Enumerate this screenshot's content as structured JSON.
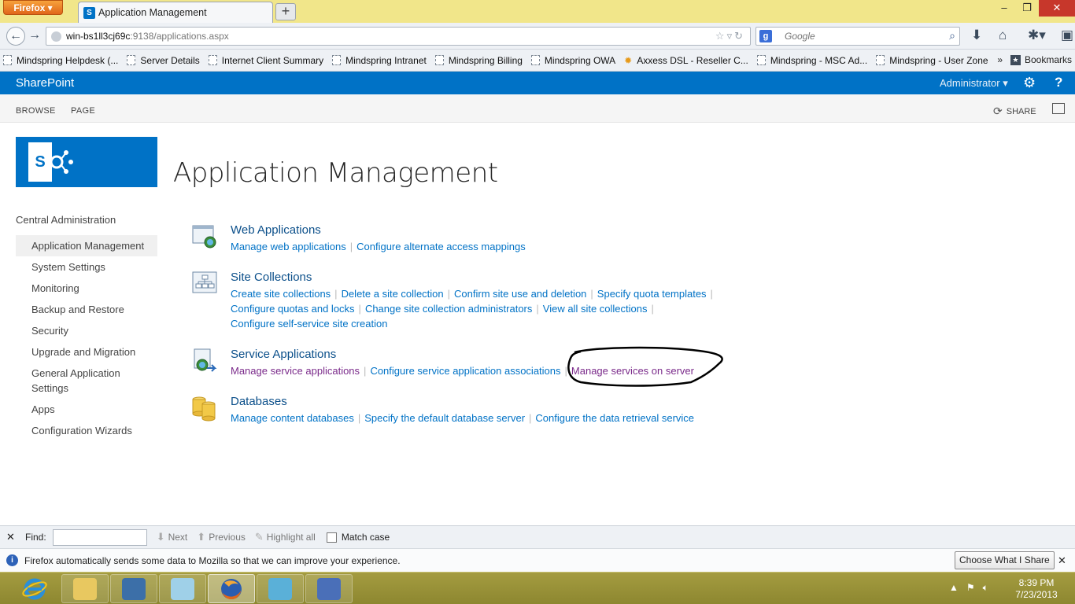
{
  "browser": {
    "menu_button": "Firefox",
    "tab_title": "Application Management",
    "new_tab": "+",
    "window_controls": {
      "minimize": "–",
      "maximize": "❐",
      "close": "✕"
    },
    "url_host": "win-bs1ll3cj69c",
    "url_rest": ":9138/applications.aspx",
    "search_placeholder": "Google",
    "bookmarks": [
      {
        "label": "Mindspring Helpdesk (...",
        "icon": "page-icon"
      },
      {
        "label": "Server Details",
        "icon": "page-icon"
      },
      {
        "label": "Internet Client Summary",
        "icon": "page-icon"
      },
      {
        "label": "Mindspring Intranet",
        "icon": "page-icon"
      },
      {
        "label": "Mindspring Billing",
        "icon": "page-icon"
      },
      {
        "label": "Mindspring OWA",
        "icon": "page-icon"
      },
      {
        "label": "Axxess DSL - Reseller C...",
        "icon": "star-icon"
      },
      {
        "label": "Mindspring - MSC Ad...",
        "icon": "page-icon"
      },
      {
        "label": "Mindspring - User Zone",
        "icon": "page-icon"
      }
    ],
    "bookmarks_more": "»",
    "bookmarks_menu": "Bookmarks"
  },
  "suite": {
    "brand": "SharePoint",
    "user": "Administrator ▾",
    "settings_icon": "gear-icon",
    "help_icon": "help-icon",
    "help_label": "?"
  },
  "ribbon": {
    "tabs": [
      "BROWSE",
      "PAGE"
    ],
    "share": "SHARE"
  },
  "page": {
    "title": "Application Management"
  },
  "quicklaunch": {
    "root": "Central Administration",
    "items": [
      {
        "label": "Application Management",
        "active": true
      },
      {
        "label": "System Settings"
      },
      {
        "label": "Monitoring"
      },
      {
        "label": "Backup and Restore"
      },
      {
        "label": "Security"
      },
      {
        "label": "Upgrade and Migration"
      },
      {
        "label": "General Application Settings"
      },
      {
        "label": "Apps"
      },
      {
        "label": "Configuration Wizards"
      }
    ]
  },
  "sections": [
    {
      "title": "Web Applications",
      "icon": "web-applications-icon",
      "lines": [
        [
          "Manage web applications",
          "Configure alternate access mappings"
        ]
      ]
    },
    {
      "title": "Site Collections",
      "icon": "site-collections-icon",
      "lines": [
        [
          "Create site collections",
          "Delete a site collection",
          "Confirm site use and deletion",
          "Specify quota templates"
        ],
        [
          "Configure quotas and locks",
          "Change site collection administrators",
          "View all site collections"
        ],
        [
          "Configure self-service site creation"
        ]
      ]
    },
    {
      "title": "Service Applications",
      "icon": "service-applications-icon",
      "lines": [
        [
          "Manage service applications",
          "Configure service application associations",
          "Manage services on server"
        ]
      ]
    },
    {
      "title": "Databases",
      "icon": "databases-icon",
      "lines": [
        [
          "Manage content databases",
          "Specify the default database server",
          "Configure the data retrieval service"
        ]
      ]
    }
  ],
  "findbar": {
    "close": "✕",
    "label": "Find:",
    "next": "Next",
    "previous": "Previous",
    "highlight": "Highlight all",
    "match_case": "Match case"
  },
  "notification": {
    "message": "Firefox automatically sends some data to Mozilla so that we can improve your experience.",
    "button": "Choose What I Share",
    "close": "✕"
  },
  "taskbar": {
    "apps": [
      {
        "name": "internet-explorer-icon",
        "color": "#2b8fd8"
      },
      {
        "name": "file-explorer-icon",
        "color": "#e8c860"
      },
      {
        "name": "server-manager-icon",
        "color": "#3c6fa8"
      },
      {
        "name": "notepad-icon",
        "color": "#9fd0e8"
      },
      {
        "name": "firefox-icon",
        "color": "#e0661a"
      },
      {
        "name": "sharepoint-management-icon",
        "color": "#5ab0d8"
      },
      {
        "name": "remote-desktop-icon",
        "color": "#4a6fb8"
      }
    ],
    "time": "8:39 PM",
    "date": "7/23/2013"
  }
}
